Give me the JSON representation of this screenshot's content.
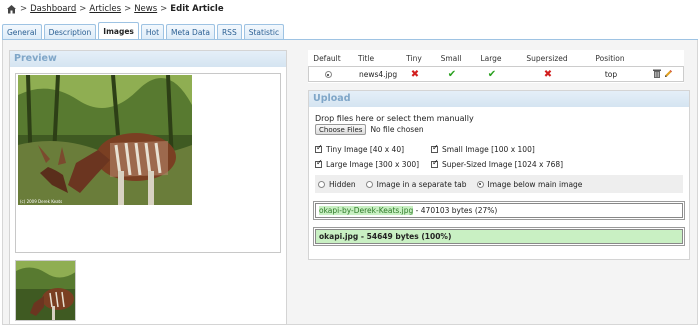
{
  "breadcrumb": {
    "items": [
      "Dashboard",
      "Articles",
      "News"
    ],
    "current": "Edit Article",
    "separator": ">"
  },
  "tabs": [
    "General",
    "Description",
    "Images",
    "Hot",
    "Meta Data",
    "RSS",
    "Statistic"
  ],
  "active_tab": "Images",
  "preview": {
    "title": "Preview",
    "caption": "(c) 2009 Derek Keats"
  },
  "images_table": {
    "headers": [
      "Default",
      "Title",
      "Tiny",
      "Small",
      "Large",
      "Supersized",
      "Position"
    ],
    "rows": [
      {
        "title": "news4.jpg",
        "tiny": "cross",
        "small": "check",
        "large": "check",
        "supersized": "cross",
        "position": "top"
      }
    ],
    "icons": {
      "delete": "trash-icon",
      "edit": "pencil-icon"
    }
  },
  "upload": {
    "title": "Upload",
    "drop_text": "Drop files here or select them manually",
    "choose_button": "Choose Files",
    "file_status": "No file chosen",
    "sizes": [
      "Tiny Image [40 x 40]",
      "Small Image [100 x 100]",
      "Large Image [300 x 300]",
      "Super-Sized Image [1024 x 768]"
    ],
    "placement": [
      "Hidden",
      "Image in a separate tab",
      "Image below main image"
    ],
    "selected_placement": "Image below main image",
    "progress": [
      {
        "name": "okapi-by-Derek-Keats.jpg",
        "detail": " - 470103 bytes (27%)",
        "percent": 27
      },
      {
        "name": "okapi.jpg - 54649 bytes (100%)",
        "detail": "",
        "percent": 100
      }
    ]
  },
  "colors": {
    "tab_border": "#9ec3e3",
    "panel_header": "#7fa6c8",
    "progress_fill": "#c9f0c3",
    "cross": "#d21e1e",
    "check": "#2aa020"
  }
}
